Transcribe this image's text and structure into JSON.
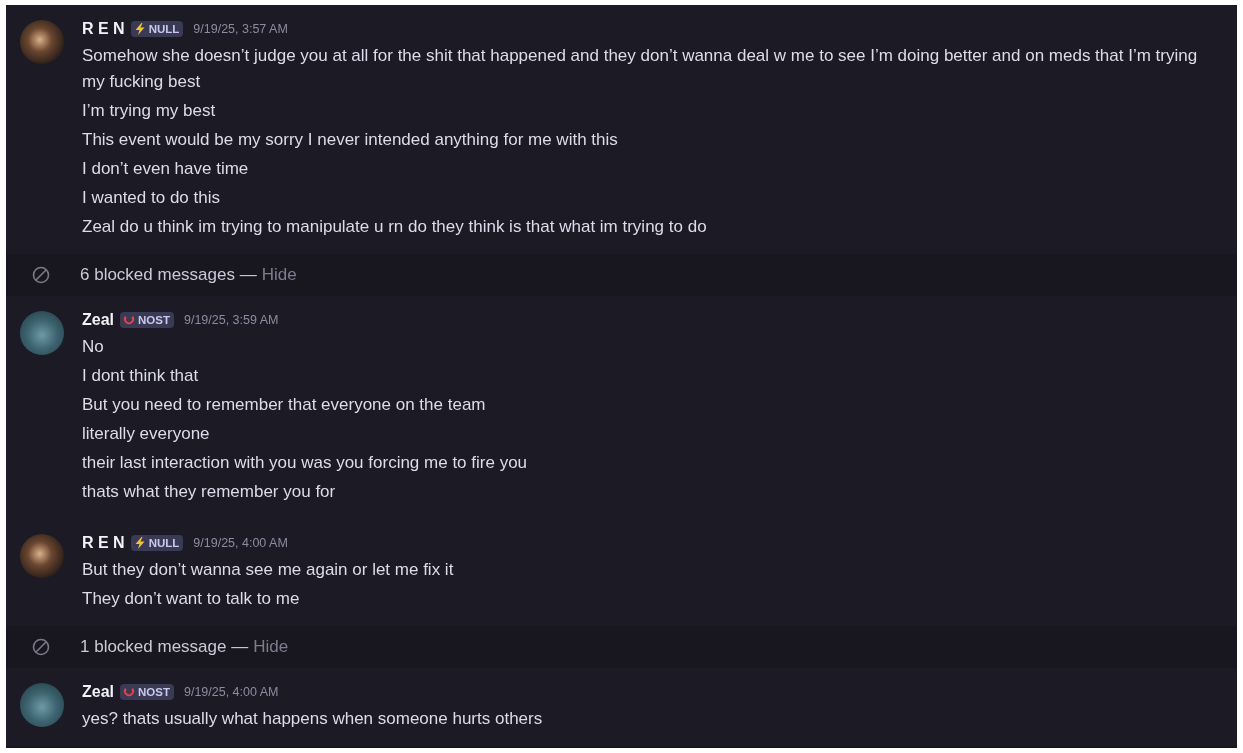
{
  "items": [
    {
      "kind": "message",
      "author": "R E N",
      "badge": {
        "kind": "bolt",
        "label": "NULL"
      },
      "time": "9/19/25, 3:57 AM",
      "lines": [
        "Somehow she doesn’t judge you at all for the shit that happened and they don’t wanna deal w me to see I’m doing better and on meds that I’m trying my fucking best",
        "I’m trying my best",
        "This event would be my sorry I never intended anything for me with this",
        "I don’t even have time",
        "I wanted to do this",
        "Zeal do u think im trying to manipulate u rn do they think is that what im trying to do"
      ]
    },
    {
      "kind": "blocked",
      "text": "6 blocked messages —",
      "action": "Hide"
    },
    {
      "kind": "message",
      "author": "Zeal",
      "badge": {
        "kind": "ring",
        "label": "NOST"
      },
      "time": "9/19/25, 3:59 AM",
      "lines": [
        "No",
        "I dont think that",
        "But you need to remember that everyone on the team",
        "literally everyone",
        "their last interaction with you was you forcing me to fire you",
        "thats what they remember you for"
      ]
    },
    {
      "kind": "message",
      "author": "R E N",
      "badge": {
        "kind": "bolt",
        "label": "NULL"
      },
      "time": "9/19/25, 4:00 AM",
      "lines": [
        "But they don’t wanna see me again or let me fix it",
        "They don’t want to talk to me"
      ]
    },
    {
      "kind": "blocked",
      "text": "1 blocked message —",
      "action": "Hide"
    },
    {
      "kind": "message",
      "author": "Zeal",
      "badge": {
        "kind": "ring",
        "label": "NOST"
      },
      "time": "9/19/25, 4:00 AM",
      "lines": [
        "yes? thats usually what happens when someone hurts others"
      ]
    }
  ]
}
